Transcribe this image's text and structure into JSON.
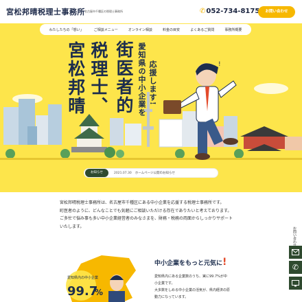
{
  "header": {
    "title": "宮松邦晴税理士事務所",
    "subtitle": "名古屋市千種区の税理士事務所",
    "phone": "052-734-8175",
    "contact_label": "お問い合わせ"
  },
  "nav": {
    "items": [
      {
        "label": "わたしたちの「想い」"
      },
      {
        "label": "ご相談メニュー"
      },
      {
        "label": "オンライン相談"
      },
      {
        "label": "料金の目安"
      },
      {
        "label": "よくあるご質問"
      },
      {
        "label": "事務所概要"
      }
    ]
  },
  "hero": {
    "col1": "宮松邦晴",
    "col2": "税理士、",
    "col3": "街医者的",
    "col4": "愛知県の中小企業を",
    "col5": "応援します!"
  },
  "notice": {
    "label": "お知らせ",
    "date": "2021.07.30",
    "text": "ホームページ公開のお知らせ"
  },
  "intro": {
    "lines": [
      "宮松邦晴税理士事務所は、名古屋市千種区にある中小企業を応援する税理士事務所です。",
      "町医者のように、どんなことでも気軽にご相談いただける存在でありたいと考えております。",
      "ご多忙で悩み事も多い中小企業経営者のみなさまを、財務・税務の両面からしっかりサポート",
      "いたします。"
    ]
  },
  "sme": {
    "title": "中小企業をもっと元気に",
    "exclaim": "!",
    "lines": [
      "愛知県内にある企業数のうち、実に99.7%が中",
      "小企業です。",
      "大多数をしめる中小企業の活気が、県内経済の原",
      "動力になっています。"
    ],
    "badge_label": "愛知県内の中小企業",
    "badge_value": "99.7",
    "badge_unit": "%"
  },
  "side": {
    "label": "お問い合わせ"
  },
  "colors": {
    "yellow": "#fde54b",
    "navy": "#1c2d4d",
    "green": "#2f4a2f",
    "accent": "#f7b800"
  }
}
